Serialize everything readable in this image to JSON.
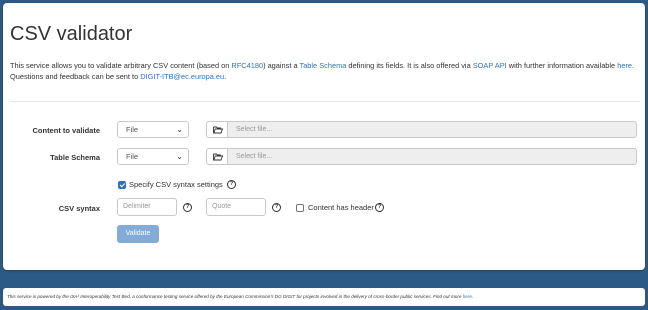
{
  "page": {
    "title": "CSV validator",
    "description": {
      "part1": "This service allows you to validate arbitrary CSV content (based on ",
      "link_rfc": "RFC4180",
      "part2": ") against a ",
      "link_table_schema": "Table Schema",
      "part3": " defining its fields. It is also offered via ",
      "link_soap": "SOAP API",
      "part4": " with further information available ",
      "link_here": "here",
      "part5": ". Questions and feedback can be sent to ",
      "link_email": "DIGIT-ITB@ec.europa.eu",
      "part6": "."
    }
  },
  "form": {
    "content_label": "Content to validate",
    "content_type": "File",
    "content_file_placeholder": "Select file...",
    "schema_label": "Table Schema",
    "schema_type": "File",
    "schema_file_placeholder": "Select file...",
    "syntax_settings_label": "Specify CSV syntax settings",
    "syntax_settings_checked": true,
    "syntax_label": "CSV syntax",
    "delimiter_placeholder": "Delimiter",
    "quote_placeholder": "Quote",
    "header_label": "Content has header",
    "header_checked": false,
    "validate_label": "Validate"
  },
  "footer": {
    "text1": "This service is powered by the ",
    "text_isa": "ISA² Interoperability Test Bed",
    "text2": ", a conformance testing service offered by the European Commission's DG DIGIT for projects involved in the delivery of cross-border public services. Find out more ",
    "link_here": "here",
    "text3": "."
  },
  "icons": {
    "folder": "folder-open-icon",
    "help": "question-circle-icon",
    "chevron": "chevron-down-icon"
  },
  "colors": {
    "background": "#2a5a85",
    "link": "#2f73b8",
    "button": "#82abd7"
  }
}
